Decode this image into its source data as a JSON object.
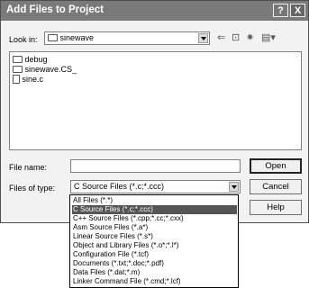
{
  "dialog": {
    "title": "Add Files to Project",
    "help_label": "?",
    "close_label": "X"
  },
  "look_in": {
    "label": "Look in:",
    "value": "sinewave"
  },
  "toolbar": {
    "back_icon": "back-arrow-icon",
    "up_icon": "up-folder-icon",
    "new_folder_icon": "new-folder-icon",
    "view_icon": "view-menu-icon"
  },
  "files": [
    {
      "name": "debug",
      "icon": "folder-icon"
    },
    {
      "name": "sinewave.CS_",
      "icon": "folder-icon"
    },
    {
      "name": "sine.c",
      "icon": "c-file-icon"
    }
  ],
  "file_name": {
    "label": "File name:",
    "value": ""
  },
  "files_of_type": {
    "label": "Files of type:",
    "value": "C Source Files (*.c;*.ccc)"
  },
  "buttons": {
    "open": "Open",
    "cancel": "Cancel",
    "help": "Help"
  },
  "type_options": [
    {
      "label": "All Files (*.*)",
      "selected": false
    },
    {
      "label": "C Source Files (*.c;*.ccc)",
      "selected": true
    },
    {
      "label": "C++ Source Files (*.cpp;*.cc;*.cxx)",
      "selected": false
    },
    {
      "label": "Asm Source Files (*.a*)",
      "selected": false
    },
    {
      "label": "Linear Source Files (*.s*)",
      "selected": false
    },
    {
      "label": "Object and Library Files (*.o*;*.l*)",
      "selected": false
    },
    {
      "label": "Configuration File (*.tcf)",
      "selected": false
    },
    {
      "label": "Documents (*.txt;*.doc;*.pdf)",
      "selected": false
    },
    {
      "label": "Data Files (*.dat;*.m)",
      "selected": false
    },
    {
      "label": "Linker Command File (*.cmd;*.lcf)",
      "selected": false
    }
  ]
}
